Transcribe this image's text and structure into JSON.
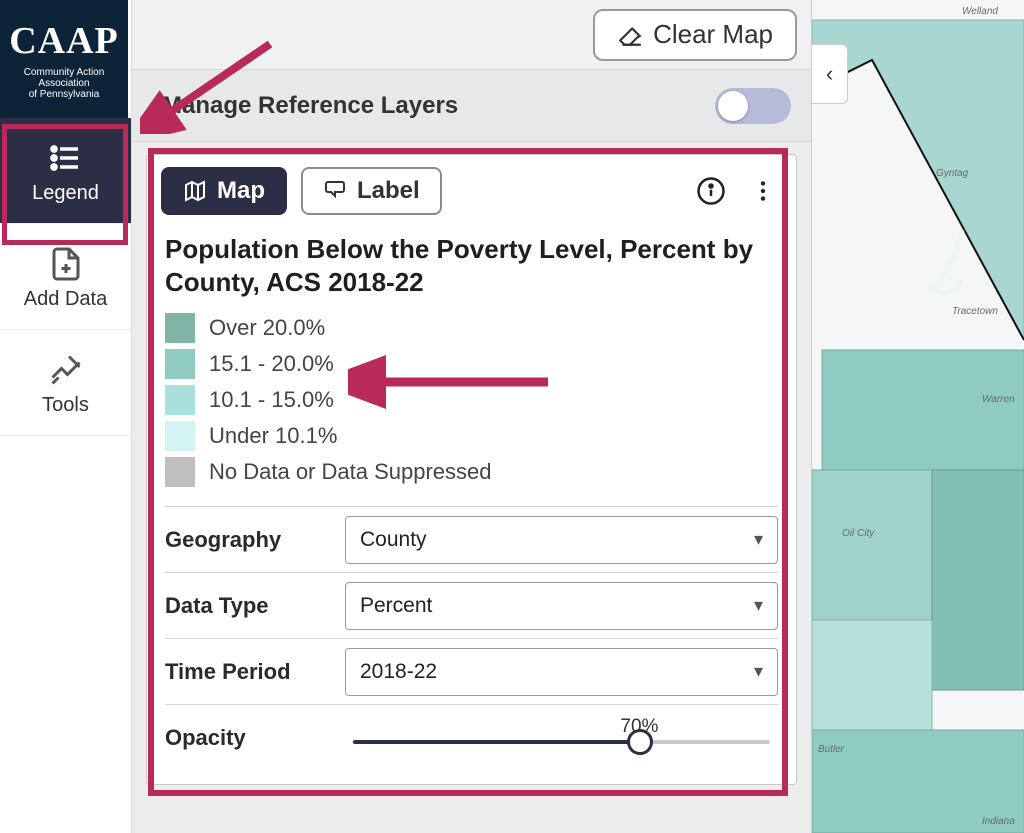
{
  "logo": {
    "title": "CAAP",
    "subtitle_l1": "Community Action",
    "subtitle_l2": "Association",
    "subtitle_l3": "of Pennsylvania"
  },
  "rail": {
    "legend": "Legend",
    "add_data": "Add Data",
    "tools": "Tools"
  },
  "topbar": {
    "clear_map": "Clear Map"
  },
  "ref": {
    "title": "Manage Reference Layers"
  },
  "tabs": {
    "map": "Map",
    "label": "Label"
  },
  "layer": {
    "title": "Population Below the Poverty Level, Percent by County, ACS 2018-22",
    "legend": {
      "b0": {
        "label": "Over 20.0%",
        "color": "#7fb4a6"
      },
      "b1": {
        "label": "15.1 - 20.0%",
        "color": "#8fcbc1"
      },
      "b2": {
        "label": "10.1 - 15.0%",
        "color": "#a9e0dc"
      },
      "b3": {
        "label": "Under 10.1%",
        "color": "#d2f4f4"
      },
      "b4": {
        "label": "No Data or Data Suppressed",
        "color": "#bfbfbf"
      }
    }
  },
  "controls": {
    "geography": {
      "label": "Geography",
      "value": "County"
    },
    "datatype": {
      "label": "Data Type",
      "value": "Percent"
    },
    "period": {
      "label": "Time Period",
      "value": "2018-22"
    },
    "opacity": {
      "label": "Opacity",
      "value": "70%",
      "pct": 70
    }
  },
  "map_labels": {
    "welland": "Welland",
    "gyntag": "Gyntag",
    "tracetown": "Tracetown",
    "warren": "Warren",
    "oilcity": "Oil City",
    "butler": "Butler",
    "indiana": "Indiana"
  },
  "colors": {
    "highlight": "#b72a5a",
    "dark": "#2c2e45"
  }
}
